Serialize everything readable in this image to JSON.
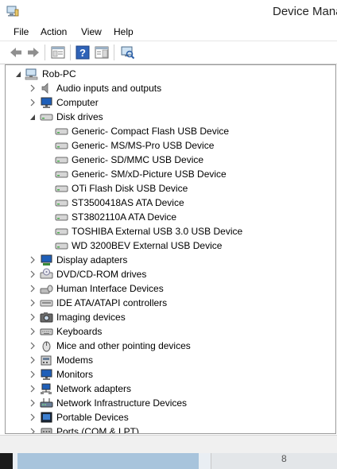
{
  "window": {
    "title": "Device Mana"
  },
  "menu": [
    "File",
    "Action",
    "View",
    "Help"
  ],
  "toolbar": {
    "buttons": [
      "back-arrow-icon",
      "forward-arrow-icon",
      "properties-window-icon",
      "help-icon",
      "action-pane-icon",
      "scan-hardware-icon"
    ]
  },
  "tree": {
    "root": "Rob-PC",
    "nodes": [
      {
        "label": "Audio inputs and outputs",
        "icon": "speaker-icon",
        "expanded": false
      },
      {
        "label": "Computer",
        "icon": "monitor-icon",
        "expanded": false
      },
      {
        "label": "Disk drives",
        "icon": "disk-drive-icon",
        "expanded": true,
        "children": [
          "Generic- Compact Flash USB Device",
          "Generic- MS/MS-Pro USB Device",
          "Generic- SD/MMC USB Device",
          "Generic- SM/xD-Picture USB Device",
          "OTi Flash Disk USB Device",
          "ST3500418AS ATA Device",
          "ST3802110A ATA Device",
          "TOSHIBA External USB 3.0 USB Device",
          "WD 3200BEV External USB Device"
        ]
      },
      {
        "label": "Display adapters",
        "icon": "display-adapter-icon",
        "expanded": false
      },
      {
        "label": "DVD/CD-ROM drives",
        "icon": "dvd-drive-icon",
        "expanded": false
      },
      {
        "label": "Human Interface Devices",
        "icon": "hid-icon",
        "expanded": false
      },
      {
        "label": "IDE ATA/ATAPI controllers",
        "icon": "ide-controller-icon",
        "expanded": false
      },
      {
        "label": "Imaging devices",
        "icon": "camera-icon",
        "expanded": false
      },
      {
        "label": "Keyboards",
        "icon": "keyboard-icon",
        "expanded": false
      },
      {
        "label": "Mice and other pointing devices",
        "icon": "mouse-icon",
        "expanded": false
      },
      {
        "label": "Modems",
        "icon": "modem-icon",
        "expanded": false
      },
      {
        "label": "Monitors",
        "icon": "monitor-icon",
        "expanded": false
      },
      {
        "label": "Network adapters",
        "icon": "network-adapter-icon",
        "expanded": false
      },
      {
        "label": "Network Infrastructure Devices",
        "icon": "network-infrastructure-icon",
        "expanded": false
      },
      {
        "label": "Portable Devices",
        "icon": "portable-device-icon",
        "expanded": false
      },
      {
        "label": "Ports (COM & LPT)",
        "icon": "port-icon",
        "expanded": false
      }
    ]
  },
  "taskbar": {
    "partial_text": "8"
  },
  "colors": {
    "selection": "#cce8ff",
    "taskbar_active": "#a8c4dc",
    "border": "#9a9a9a"
  }
}
